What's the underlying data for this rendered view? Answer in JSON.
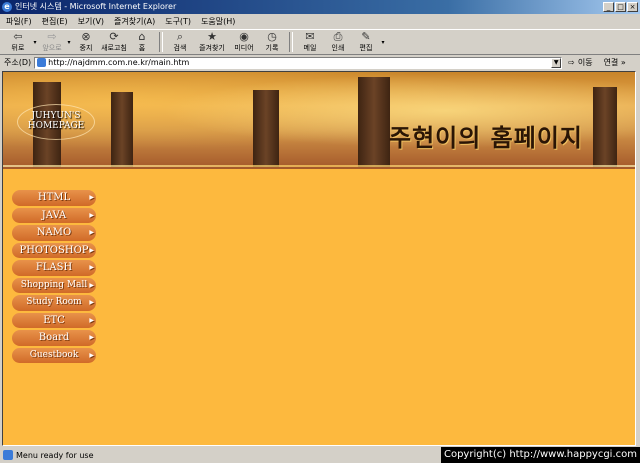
{
  "window": {
    "title": "인터넷 시스템 - Microsoft Internet Explorer",
    "buttons": [
      "_",
      "□",
      "×"
    ]
  },
  "menubar": [
    "파일(F)",
    "편집(E)",
    "보기(V)",
    "즐겨찾기(A)",
    "도구(T)",
    "도움말(H)"
  ],
  "toolbar": [
    {
      "label": "뒤로",
      "icon": "back-arrow-icon",
      "glyph": "⇦",
      "enabled": true
    },
    {
      "label": "앞으로",
      "icon": "forward-arrow-icon",
      "glyph": "⇨",
      "enabled": false
    },
    {
      "label": "중지",
      "icon": "stop-icon",
      "glyph": "⊗",
      "enabled": true
    },
    {
      "label": "새로고침",
      "icon": "refresh-icon",
      "glyph": "⟳",
      "enabled": true
    },
    {
      "label": "홈",
      "icon": "home-icon",
      "glyph": "⌂",
      "enabled": true
    },
    {
      "label": "검색",
      "icon": "search-icon",
      "glyph": "⌕",
      "enabled": true
    },
    {
      "label": "즐겨찾기",
      "icon": "favorites-icon",
      "glyph": "★",
      "enabled": true
    },
    {
      "label": "미디어",
      "icon": "media-icon",
      "glyph": "◉",
      "enabled": true
    },
    {
      "label": "기록",
      "icon": "history-icon",
      "glyph": "◷",
      "enabled": true
    },
    {
      "label": "메일",
      "icon": "mail-icon",
      "glyph": "✉",
      "enabled": true
    },
    {
      "label": "인쇄",
      "icon": "print-icon",
      "glyph": "⎙",
      "enabled": true
    },
    {
      "label": "편집",
      "icon": "edit-icon",
      "glyph": "✎",
      "enabled": true
    }
  ],
  "address": {
    "label": "주소(D)",
    "value": "http://najdmm.com.ne.kr/main.htm",
    "go_label": "이동",
    "links_label": "연결 »"
  },
  "banner": {
    "logo_text": "JUHYUN'S HOMEPAGE",
    "title": "주현이의 홈페이지"
  },
  "nav": [
    "HTML",
    "JAVA",
    "NAMO",
    "PHOTOSHOP",
    "FLASH",
    "Shopping Mall",
    "Study Room",
    "ETC",
    "Board",
    "Guestbook"
  ],
  "status": {
    "text": "Menu ready for use"
  },
  "copyright": "Copyright(c) http://www.happycgi.com",
  "colors": {
    "page_bg": "#fdb93e",
    "nav_button": "#d9783a",
    "titlebar": "#0a246a"
  }
}
